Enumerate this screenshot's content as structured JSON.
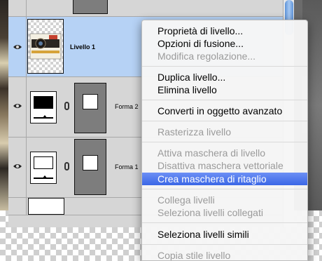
{
  "layers": [
    {
      "name": "",
      "type": "shape-partial"
    },
    {
      "name": "Livello 1",
      "type": "image",
      "selected": true
    },
    {
      "name": "Forma 2",
      "type": "shape-black"
    },
    {
      "name": "Forma 1",
      "type": "shape-white"
    },
    {
      "name": "",
      "type": "white-partial"
    }
  ],
  "context_menu": {
    "items": [
      {
        "label": "Proprietà di livello...",
        "enabled": true
      },
      {
        "label": "Opzioni di fusione...",
        "enabled": true
      },
      {
        "label": "Modifica regolazione...",
        "enabled": false
      },
      {
        "label": "Duplica livello...",
        "enabled": true
      },
      {
        "label": "Elimina livello",
        "enabled": true
      },
      {
        "label": "Converti in oggetto avanzato",
        "enabled": true
      },
      {
        "label": "Rasterizza livello",
        "enabled": false
      },
      {
        "label": "Attiva maschera di livello",
        "enabled": false
      },
      {
        "label": "Disattiva maschera vettoriale",
        "enabled": false
      },
      {
        "label": "Crea maschera di ritaglio",
        "enabled": true,
        "highlighted": true
      },
      {
        "label": "Collega livelli",
        "enabled": false
      },
      {
        "label": "Seleziona livelli collegati",
        "enabled": false
      },
      {
        "label": "Seleziona livelli simili",
        "enabled": true
      },
      {
        "label": "Copia stile livello",
        "enabled": false
      }
    ]
  },
  "colors": {
    "selection": "#b6d2f5",
    "menu_highlight": "#3b67e6",
    "disabled_text": "#9a9a9a"
  },
  "icons": [
    "eye-icon",
    "link-chain-icon"
  ]
}
